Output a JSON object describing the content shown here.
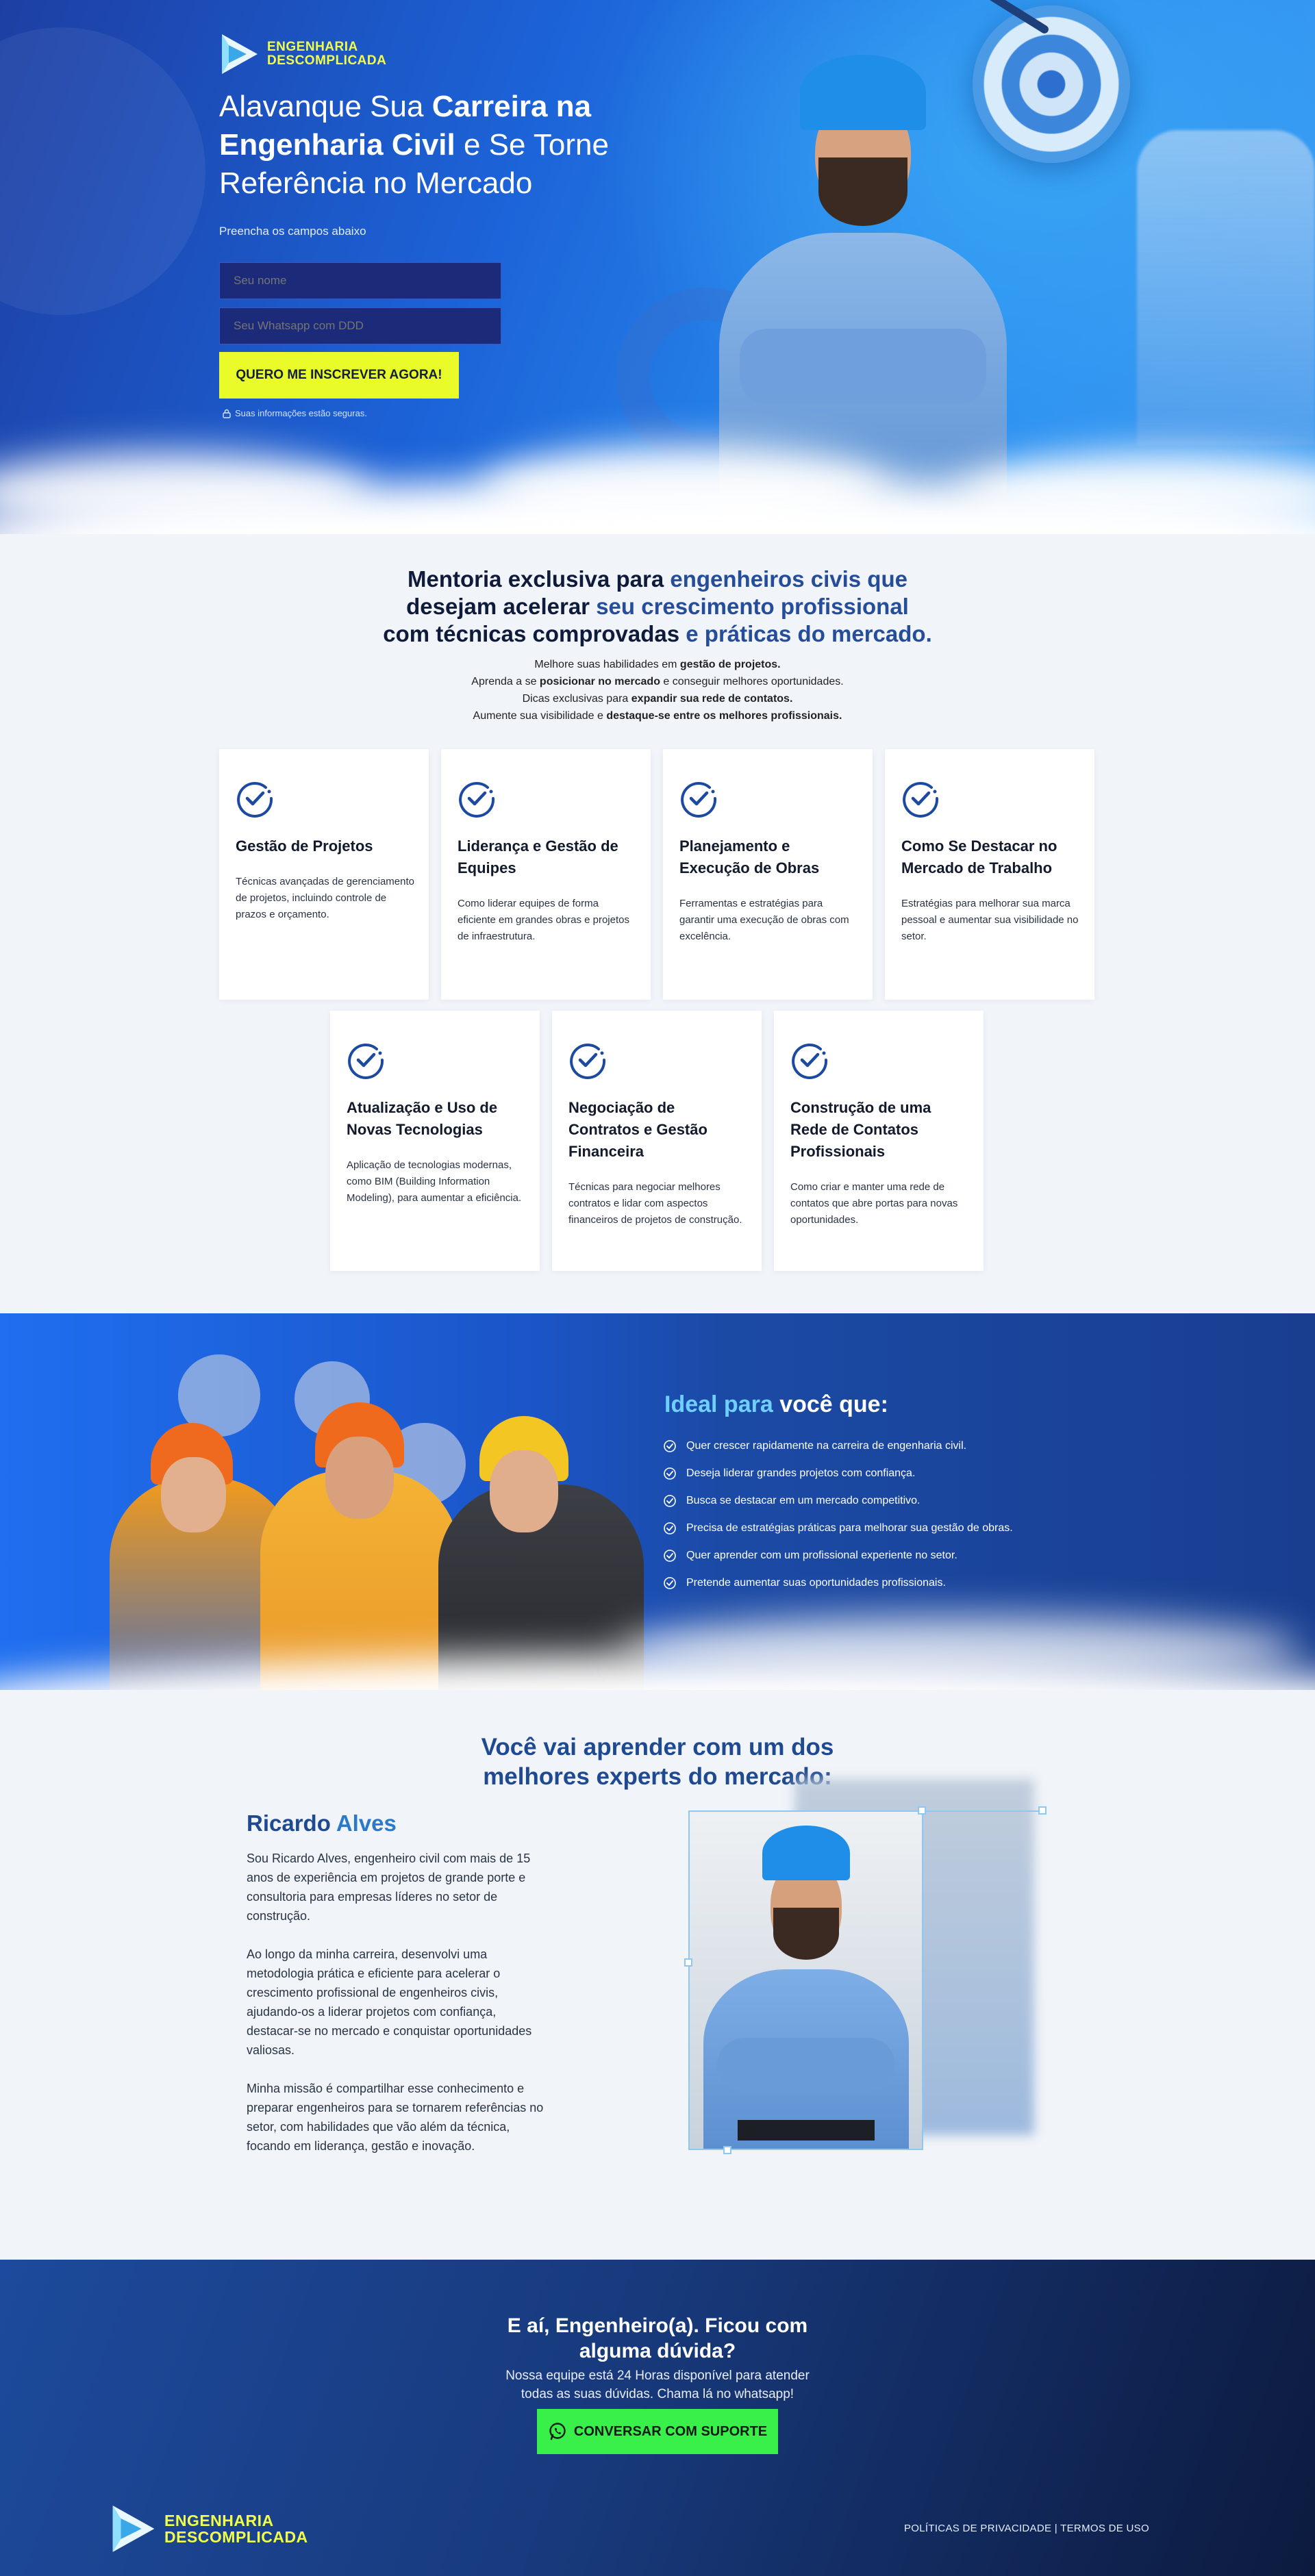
{
  "brand": {
    "line1": "ENGENHARIA",
    "line2": "DESCOMPLICADA"
  },
  "hero": {
    "headline_1": "Alavanque Sua ",
    "headline_bold_1": "Carreira na Engenharia Civil",
    "headline_2": " e Se Torne Referência no Mercado",
    "hint": "Preencha os campos abaixo",
    "name_placeholder": "Seu nome",
    "whatsapp_placeholder": "Seu Whatsapp com DDD",
    "cta": "QUERO ME INSCREVER AGORA!",
    "secure": "Suas informações estão seguras."
  },
  "mentoria": {
    "t1a": "Mentoria exclusiva ",
    "t1b": "para ",
    "t1c": "engenheiros civis",
    "t1d": " que",
    "t2a": "desejam acelerar ",
    "t2b": "seu crescimento",
    "t2c": " profissional",
    "t3a": "com técnicas comprovadas",
    "t3b": " e ",
    "t3c": "práticas do mercado.",
    "bullets": [
      {
        "pre": "Melhore suas habilidades em ",
        "bold": "gestão de projetos.",
        "post": ""
      },
      {
        "pre": "Aprenda a se ",
        "bold": "posicionar no mercado",
        "post": " e conseguir melhores oportunidades."
      },
      {
        "pre": "Dicas exclusivas para ",
        "bold": "expandir sua rede de contatos.",
        "post": ""
      },
      {
        "pre": "Aumente sua visibilidade e ",
        "bold": "destaque-se entre os melhores profissionais.",
        "post": ""
      }
    ],
    "cards": [
      {
        "title": "Gestão de Projetos",
        "text": "Técnicas avançadas de gerenciamento de projetos, incluindo controle de prazos e orçamento."
      },
      {
        "title": "Liderança e Gestão de Equipes",
        "text": "Como liderar equipes de forma eficiente em grandes obras e projetos de infraestrutura."
      },
      {
        "title": "Planejamento e Execução  de Obras",
        "text": "Ferramentas e estratégias para garantir uma execução de obras com excelência."
      },
      {
        "title": "Como Se Destacar no Mercado de Trabalho",
        "text": "Estratégias para melhorar sua marca pessoal e aumentar sua visibilidade no setor."
      },
      {
        "title": "Atualização e Uso de Novas Tecnologias",
        "text": "Aplicação de tecnologias modernas, como BIM (Building Information Modeling), para aumentar a eficiência."
      },
      {
        "title": "Negociação de Contratos e Gestão Financeira",
        "text": "Técnicas para negociar melhores contratos e lidar com aspectos financeiros de projetos de construção."
      },
      {
        "title": "Construção de uma Rede de Contatos Profissionais",
        "text": "Como criar e manter uma rede de contatos que abre portas para novas oportunidades."
      }
    ]
  },
  "ideal": {
    "title_a": "Ideal para",
    "title_b": " você que:",
    "items": [
      "Quer crescer rapidamente na carreira de engenharia civil.",
      "Deseja liderar grandes projetos com confiança.",
      "Busca se destacar em um mercado competitivo.",
      "Precisa de estratégias práticas para melhorar sua gestão de obras.",
      "Quer aprender com um profissional experiente no setor.",
      "Pretende aumentar suas oportunidades profissionais."
    ]
  },
  "expert": {
    "title_1": "Você vai aprender com um dos",
    "title_2": "melhores experts do mercado:",
    "first": "Ricardo",
    "last": " Alves",
    "p1": "Sou Ricardo Alves, engenheiro civil com mais de 15 anos de experiência em projetos de grande porte e consultoria para empresas líderes no setor de construção.",
    "p2": "Ao longo da minha carreira, desenvolvi uma metodologia prática e eficiente para acelerar o crescimento profissional de engenheiros civis, ajudando-os a liderar projetos com confiança, destacar-se no mercado e conquistar oportunidades valiosas.",
    "p3": "Minha missão é compartilhar esse conhecimento e preparar engenheiros para se tornarem referências no setor, com habilidades que vão além da técnica, focando em liderança, gestão e inovação."
  },
  "contact": {
    "title_1": "E aí, Engenheiro(a). Ficou com",
    "title_2": "alguma dúvida?",
    "sub_1": "Nossa equipe está 24 Horas disponível para atender",
    "sub_2": "todas as suas dúvidas. Chama lá no whatsapp!",
    "button": "CONVERSAR COM SUPORTE"
  },
  "footer": {
    "links": "POLÍTICAS DE PRIVACIDADE | TERMOS DE USO"
  },
  "colors": {
    "accent_yellow": "#e9fb28",
    "whatsapp_green": "#39f04a",
    "primary_blue": "#1f4a91",
    "dark_navy": "#0c1a3e"
  }
}
